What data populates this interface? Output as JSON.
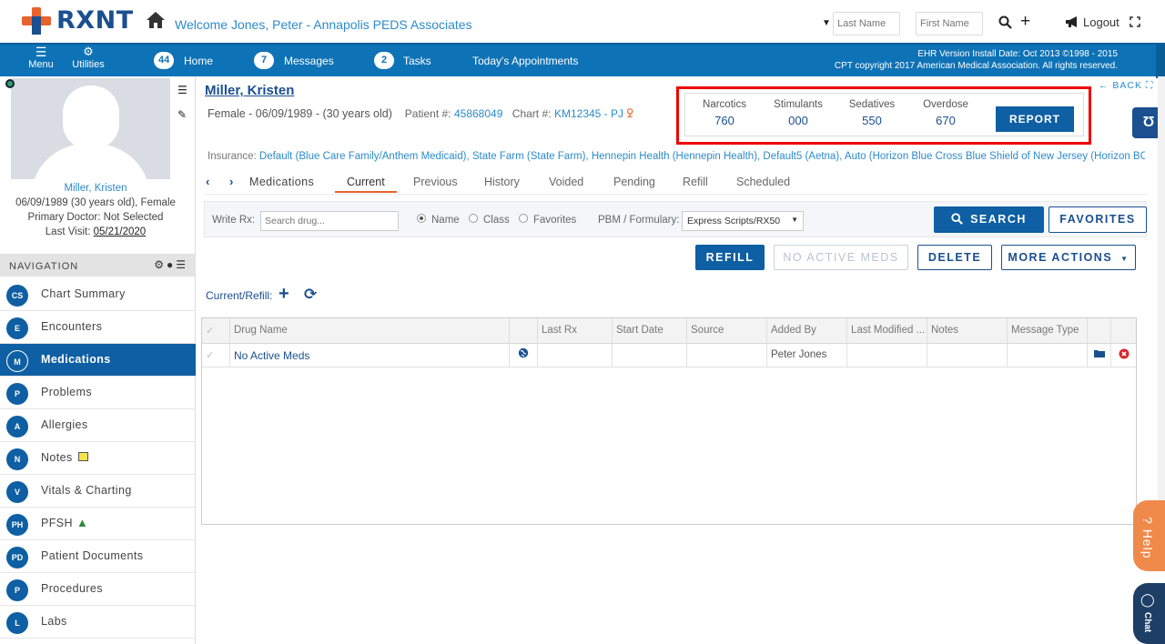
{
  "header": {
    "logo_text": "RXNT",
    "welcome": "Welcome  Jones, Peter - Annapolis PEDS Associates",
    "last_name_placeholder": "Last Name",
    "first_name_placeholder": "First Name",
    "logout": "Logout"
  },
  "navbar": {
    "menu": "Menu",
    "utilities": "Utilities",
    "home_count": "44",
    "home": "Home",
    "messages_count": "7",
    "messages": "Messages",
    "tasks_count": "2",
    "tasks": "Tasks",
    "appointments": "Today's Appointments",
    "ehr_line1": "EHR Version Install Date: Oct 2013 ©1998 - 2015",
    "ehr_line2": "CPT copyright 2017 American Medical Association. All rights reserved."
  },
  "sidebar": {
    "patient_name": "Miller, Kristen",
    "patient_dob": "06/09/1989 (30 years old), Female",
    "primary_doctor": "Primary Doctor: Not Selected",
    "last_visit_label": "Last Visit:",
    "last_visit": "05/21/2020",
    "nav_title": "NAVIGATION",
    "items": [
      {
        "code": "CS",
        "label": "Chart Summary"
      },
      {
        "code": "E",
        "label": "Encounters"
      },
      {
        "code": "M",
        "label": "Medications"
      },
      {
        "code": "P",
        "label": "Problems"
      },
      {
        "code": "A",
        "label": "Allergies"
      },
      {
        "code": "N",
        "label": "Notes"
      },
      {
        "code": "V",
        "label": "Vitals & Charting"
      },
      {
        "code": "PH",
        "label": "PFSH"
      },
      {
        "code": "PD",
        "label": "Patient Documents"
      },
      {
        "code": "P",
        "label": "Procedures"
      },
      {
        "code": "L",
        "label": "Labs"
      }
    ]
  },
  "patient": {
    "name": "Miller, Kristen",
    "summary": "Female - 06/09/1989 - (30 years old)",
    "patient_num_label": "Patient #:",
    "patient_num": "45868049",
    "chart_num_label": "Chart #:",
    "chart_num": "KM12345 - PJ",
    "insurance_label": "Insurance:",
    "insurance": "Default (Blue Care Family/Anthem Medicaid), State Farm (State Farm), Hennepin Health (Hennepin Health), Default5 (Aetna), Auto (Horizon Blue Cross Blue Shield of New Jersey (Horizon BCBSNJ))"
  },
  "pmp": {
    "narcotics_label": "Narcotics",
    "narcotics": "760",
    "stimulants_label": "Stimulants",
    "stimulants": "000",
    "sedatives_label": "Sedatives",
    "sedatives": "550",
    "overdose_label": "Overdose",
    "overdose": "670",
    "report": "REPORT"
  },
  "back": "BACK",
  "tabs": {
    "medications": "Medications",
    "current": "Current",
    "previous": "Previous",
    "history": "History",
    "voided": "Voided",
    "pending": "Pending",
    "refill": "Refill",
    "scheduled": "Scheduled"
  },
  "write_rx": {
    "label": "Write Rx:",
    "placeholder": "Search drug...",
    "name": "Name",
    "class": "Class",
    "favorites": "Favorites",
    "pbm_label": "PBM / Formulary:",
    "pbm_value": "Express Scripts/RX50",
    "search": "SEARCH",
    "favorites_btn": "FAVORITES"
  },
  "actions": {
    "refill": "REFILL",
    "no_active": "NO ACTIVE MEDS",
    "delete": "DELETE",
    "more": "MORE ACTIONS"
  },
  "current_refill": "Current/Refill:",
  "table": {
    "columns": [
      "Drug Name",
      "Last Rx",
      "Start Date",
      "Source",
      "Added By",
      "Last Modified ...",
      "Notes",
      "Message Type"
    ],
    "rows": [
      {
        "drug": "No Active Meds",
        "added_by": "Peter Jones"
      }
    ]
  },
  "help": "Help",
  "chat": "Chat"
}
